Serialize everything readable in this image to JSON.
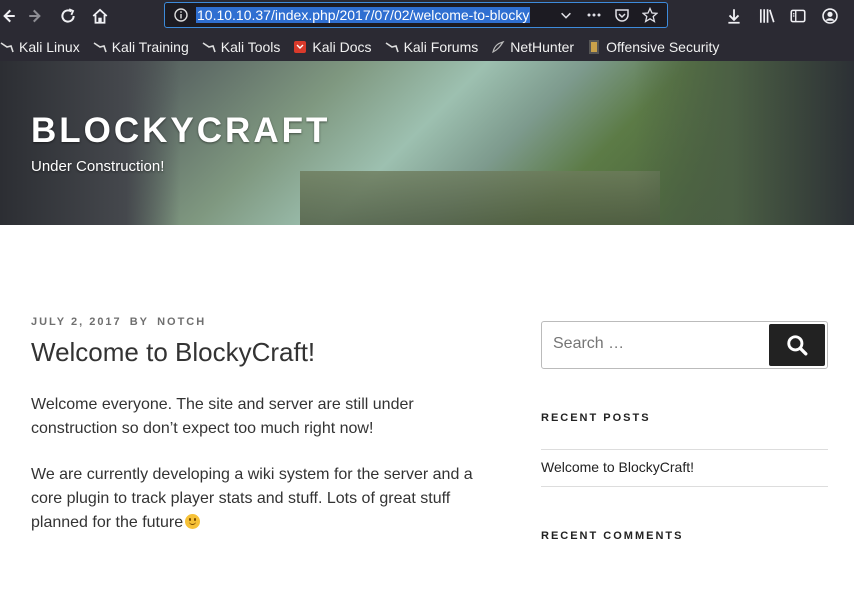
{
  "browser": {
    "url": "10.10.10.37/index.php/2017/07/02/welcome-to-blocky",
    "bookmarks": [
      {
        "label": "Kali Linux",
        "icon": "kali-dragon-icon"
      },
      {
        "label": "Kali Training",
        "icon": "kali-dragon-icon"
      },
      {
        "label": "Kali Tools",
        "icon": "kali-dragon-icon"
      },
      {
        "label": "Kali Docs",
        "icon": "kali-docs-icon"
      },
      {
        "label": "Kali Forums",
        "icon": "kali-dragon-icon"
      },
      {
        "label": "NetHunter",
        "icon": "nethunter-icon"
      },
      {
        "label": "Offensive Security",
        "icon": "offsec-icon"
      }
    ]
  },
  "site": {
    "title": "BLOCKYCRAFT",
    "description": "Under Construction!"
  },
  "post": {
    "date": "JULY 2, 2017",
    "by": "BY",
    "author": "NOTCH",
    "title": "Welcome to BlockyCraft!",
    "paragraphs": [
      "Welcome everyone. The site and server are still under construction so don’t expect too much right now!",
      "We are currently developing a wiki system for the server and a core plugin to track player stats and stuff. Lots of great stuff planned for the future"
    ]
  },
  "sidebar": {
    "search_placeholder": "Search …",
    "recent_posts_title": "RECENT POSTS",
    "recent_posts": [
      "Welcome to BlockyCraft!"
    ],
    "recent_comments_title": "RECENT COMMENTS"
  },
  "colors": {
    "browser_bg": "#2b2a33",
    "url_highlight": "#2f6fd1",
    "search_button": "#222222"
  }
}
